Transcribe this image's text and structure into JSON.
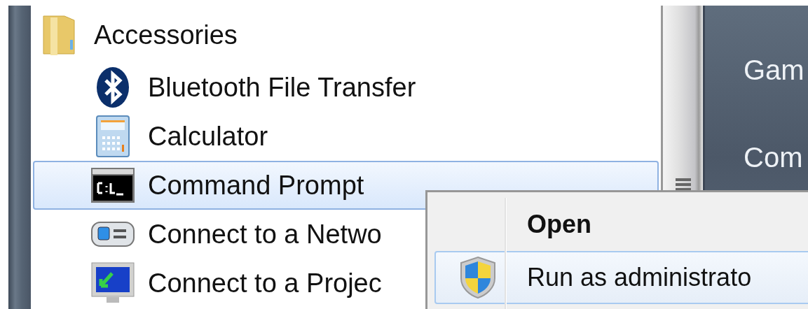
{
  "programs": {
    "folder": {
      "label": "Accessories",
      "kind": "folder",
      "children": [
        {
          "label": "Bluetooth File Transfer",
          "kind": "bluetooth",
          "selected": false
        },
        {
          "label": "Calculator",
          "kind": "calculator",
          "selected": false
        },
        {
          "label": "Command Prompt",
          "kind": "console",
          "selected": true
        },
        {
          "label": "Connect to a Netwo",
          "kind": "network",
          "selected": false
        },
        {
          "label": "Connect to a Projec",
          "kind": "projector",
          "selected": false
        }
      ]
    }
  },
  "right_panel": {
    "items": [
      {
        "label": "Gam"
      },
      {
        "label": "Com"
      }
    ]
  },
  "context_menu": {
    "items": [
      {
        "label": "Open",
        "default": true,
        "kind": "plain",
        "selected": false
      },
      {
        "label": "Run as administrato",
        "default": false,
        "kind": "shield",
        "selected": true
      }
    ]
  }
}
